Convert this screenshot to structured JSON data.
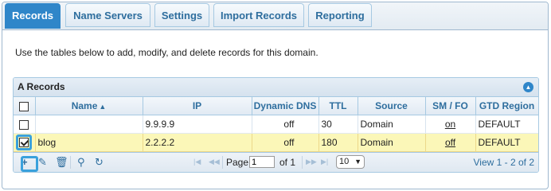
{
  "tabs": [
    {
      "label": "Records",
      "active": true
    },
    {
      "label": "Name Servers",
      "active": false
    },
    {
      "label": "Settings",
      "active": false
    },
    {
      "label": "Import Records",
      "active": false
    },
    {
      "label": "Reporting",
      "active": false
    }
  ],
  "intro_text": "Use the tables below to add, modify, and delete records for this domain.",
  "grid": {
    "title": "A Records",
    "columns": [
      "Name",
      "IP",
      "Dynamic DNS",
      "TTL",
      "Source",
      "SM / FO",
      "GTD Region"
    ],
    "rows": [
      {
        "checked": false,
        "name": "",
        "ip": "9.9.9.9",
        "dynamic_dns": "off",
        "ttl": "30",
        "source": "Domain",
        "smfo": "on",
        "gtd_region": "DEFAULT",
        "selected": false
      },
      {
        "checked": true,
        "name": "blog",
        "ip": "2.2.2.2",
        "dynamic_dns": "off",
        "ttl": "180",
        "source": "Domain",
        "smfo": "off",
        "gtd_region": "DEFAULT",
        "selected": true
      }
    ]
  },
  "pager": {
    "page_label": "Page",
    "page_value": "1",
    "of_label": "of 1",
    "page_size": "10",
    "view_text": "View 1 - 2 of 2"
  },
  "icons": {
    "add": "add-icon",
    "edit": "edit-icon",
    "delete": "trash-icon",
    "search": "search-icon",
    "refresh": "refresh-icon"
  },
  "colors": {
    "accent": "#2f86c9",
    "selected_row": "#fbf7b8",
    "highlight": "#3aa1dc"
  }
}
